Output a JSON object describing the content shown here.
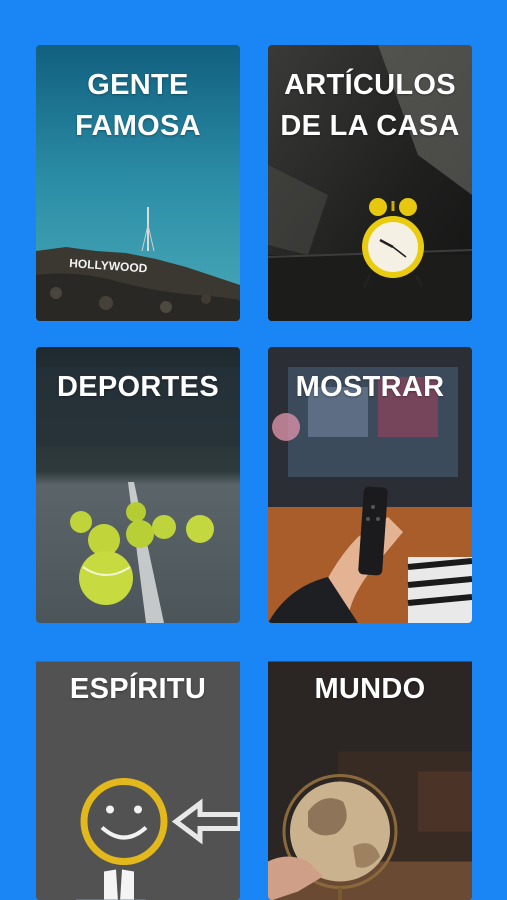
{
  "categories": [
    {
      "title": "GENTE FAMOSA",
      "image": "hollywood-sign-photo"
    },
    {
      "title": "ARTÍCULOS DE LA CASA",
      "image": "alarm-clock-photo"
    },
    {
      "title": "DEPORTES",
      "image": "tennis-balls-photo"
    },
    {
      "title": "MOSTRAR",
      "image": "tv-remote-photo"
    },
    {
      "title": "ESPÍRITU",
      "image": "smiley-face-pavement-photo"
    },
    {
      "title": "MUNDO",
      "image": "globe-photo"
    }
  ],
  "sign_text": "HOLLYWOOD"
}
